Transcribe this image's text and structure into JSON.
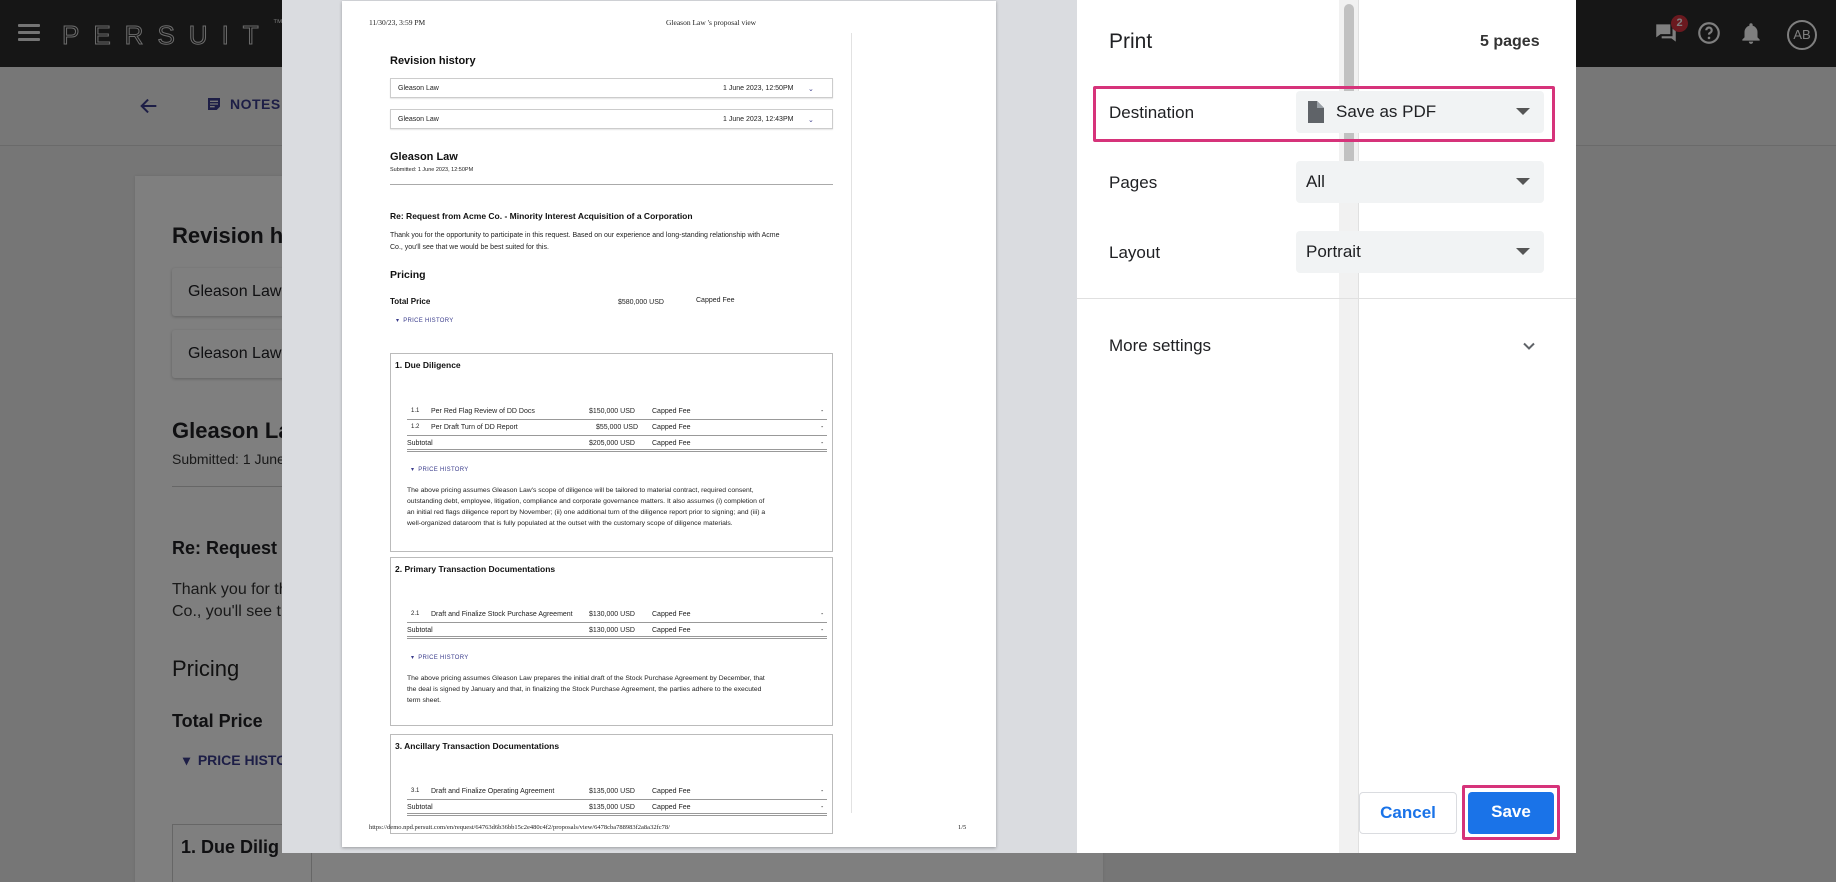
{
  "app": {
    "logo": "PERSUIT",
    "logo_tm": "™",
    "chat_badge": "2",
    "avatar": "AB",
    "notes_label": "NOTES"
  },
  "background": {
    "revision_heading": "Revision h",
    "rev_item_1": "Gleason Law",
    "rev_item_2": "Gleason Law",
    "firm_name": "Gleason La",
    "submitted": "Submitted: 1 June",
    "re_heading": "Re: Request",
    "intro_line_1": "Thank you for th",
    "intro_line_2": "Co., you'll see th",
    "pricing": "Pricing",
    "total_price": "Total Price",
    "price_history": "PRICE HISTO",
    "due_diligence": "1.  Due Dilig"
  },
  "preview": {
    "header_date": "11/30/23, 3:59 PM",
    "header_title": "Gleason Law 's proposal view",
    "revision_history": "Revision history",
    "revisions": [
      {
        "name": "Gleason Law",
        "date": "1 June 2023, 12:50PM"
      },
      {
        "name": "Gleason Law",
        "date": "1 June 2023, 12:43PM"
      }
    ],
    "firm": "Gleason Law",
    "submitted": "Submitted: 1 June 2023, 12:50PM",
    "re": "Re: Request from Acme Co. - Minority Interest Acquisition of a Corporation",
    "intro_1": "Thank you for the opportunity to participate in this request. Based on our experience and long-standing relationship with Acme",
    "intro_2": "Co., you'll see that we would be best suited for this.",
    "pricing": "Pricing",
    "total_price_label": "Total Price",
    "total_price_value": "$580,000 USD",
    "total_price_type": "Capped Fee",
    "price_history": "PRICE HISTORY",
    "sections": [
      {
        "title": "1.  Due Diligence",
        "rows": [
          {
            "num": "1.1",
            "desc": "Per Red Flag Review of DD Docs",
            "amount": "$150,000 USD",
            "type": "Capped Fee",
            "dash": "-"
          },
          {
            "num": "1.2",
            "desc": "Per Draft Turn of DD Report",
            "amount": "$55,000 USD",
            "type": "Capped Fee",
            "dash": "-"
          }
        ],
        "subtotal_label": "Subtotal",
        "subtotal_amount": "$205,000 USD",
        "subtotal_type": "Capped Fee",
        "subtotal_dash": "-",
        "price_history": "PRICE HISTORY",
        "note": [
          "The above pricing assumes Gleason Law's scope of diligence will be tailored to material contract, required consent,",
          "outstanding debt, employee, litigation, compliance and corporate governance matters.  It also assumes (i) completion of",
          "an initial red flags diligence report by November; (ii) one additional turn of the diligence report prior to signing; and (iii) a",
          "well-organized dataroom that is fully populated at the outset with the customary scope of diligence materials."
        ]
      },
      {
        "title": "2.  Primary Transaction Documentations",
        "rows": [
          {
            "num": "2.1",
            "desc": "Draft and Finalize Stock Purchase Agreement",
            "amount": "$130,000 USD",
            "type": "Capped Fee",
            "dash": "-"
          }
        ],
        "subtotal_label": "Subtotal",
        "subtotal_amount": "$130,000 USD",
        "subtotal_type": "Capped Fee",
        "subtotal_dash": "-",
        "price_history": "PRICE HISTORY",
        "note": [
          "The above pricing assumes Gleason Law prepares the initial draft of the Stock Purchase Agreement by December, that",
          "the deal is signed by January and that, in finalizing the Stock Purchase Agreement, the parties adhere to the executed",
          "term sheet."
        ]
      },
      {
        "title": "3.  Ancillary Transaction Documentations",
        "rows": [
          {
            "num": "3.1",
            "desc": "Draft and Finalize Operating Agreement",
            "amount": "$135,000 USD",
            "type": "Capped Fee",
            "dash": "-"
          }
        ],
        "subtotal_label": "Subtotal",
        "subtotal_amount": "$135,000 USD",
        "subtotal_type": "Capped Fee",
        "subtotal_dash": "-"
      }
    ],
    "footer_url": "https://demo.npd.persuit.com/en/request/64763d6b36bb15c2e480c4f2/proposals/view/6478cba788983f2a8a32fc78/",
    "footer_page": "1/5"
  },
  "print": {
    "title": "Print",
    "page_count": "5 pages",
    "destination_label": "Destination",
    "destination_value": "Save as PDF",
    "pages_label": "Pages",
    "pages_value": "All",
    "layout_label": "Layout",
    "layout_value": "Portrait",
    "more_settings": "More settings",
    "cancel": "Cancel",
    "save": "Save"
  },
  "colors": {
    "highlight": "#d6337a",
    "primary": "#1a73e8",
    "topbar": "#2c2c2c",
    "badge": "#d6323e"
  }
}
